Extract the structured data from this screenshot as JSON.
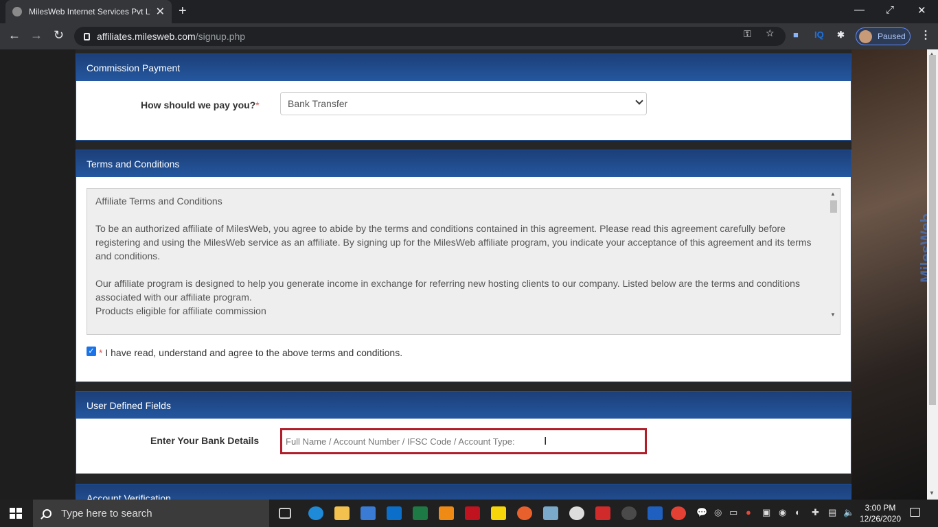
{
  "browser": {
    "tab_title": "MilesWeb Internet Services Pvt Lt",
    "url_host": "affiliates.milesweb.com",
    "url_path": "/signup.php",
    "profile_status": "Paused",
    "ext_iq_label": "IQ"
  },
  "commission": {
    "heading": "Commission Payment",
    "pay_label": "How should we pay you?",
    "required_mark": "*",
    "pay_value": "Bank Transfer"
  },
  "terms": {
    "heading": "Terms and Conditions",
    "title": "Affiliate Terms and Conditions",
    "para1": "To be an authorized affiliate of MilesWeb, you agree to abide by the terms and conditions contained in this agreement. Please read this agreement carefully before registering and using the MilesWeb service as an affiliate. By signing up for the MilesWeb affiliate program, you indicate your acceptance of this agreement and its terms and conditions.",
    "para2": "Our affiliate program is designed to help you generate income in exchange for referring new hosting clients to our company. Listed below are the terms and conditions associated with our affiliate program.",
    "para3": "Products eligible for affiliate commission",
    "agree_required": "*",
    "agree_text": "I have read, understand and agree to the above terms and conditions.",
    "agree_checked": true
  },
  "user_fields": {
    "heading": "User Defined Fields",
    "bank_label": "Enter Your Bank Details",
    "bank_placeholder": "Full Name / Account Number / IFSC Code / Account Type:"
  },
  "verification": {
    "heading": "Account Verification"
  },
  "watermark": "MilesWeb",
  "taskbar": {
    "search_placeholder": "Type here to search",
    "time": "3:00 PM",
    "date": "12/26/2020"
  }
}
